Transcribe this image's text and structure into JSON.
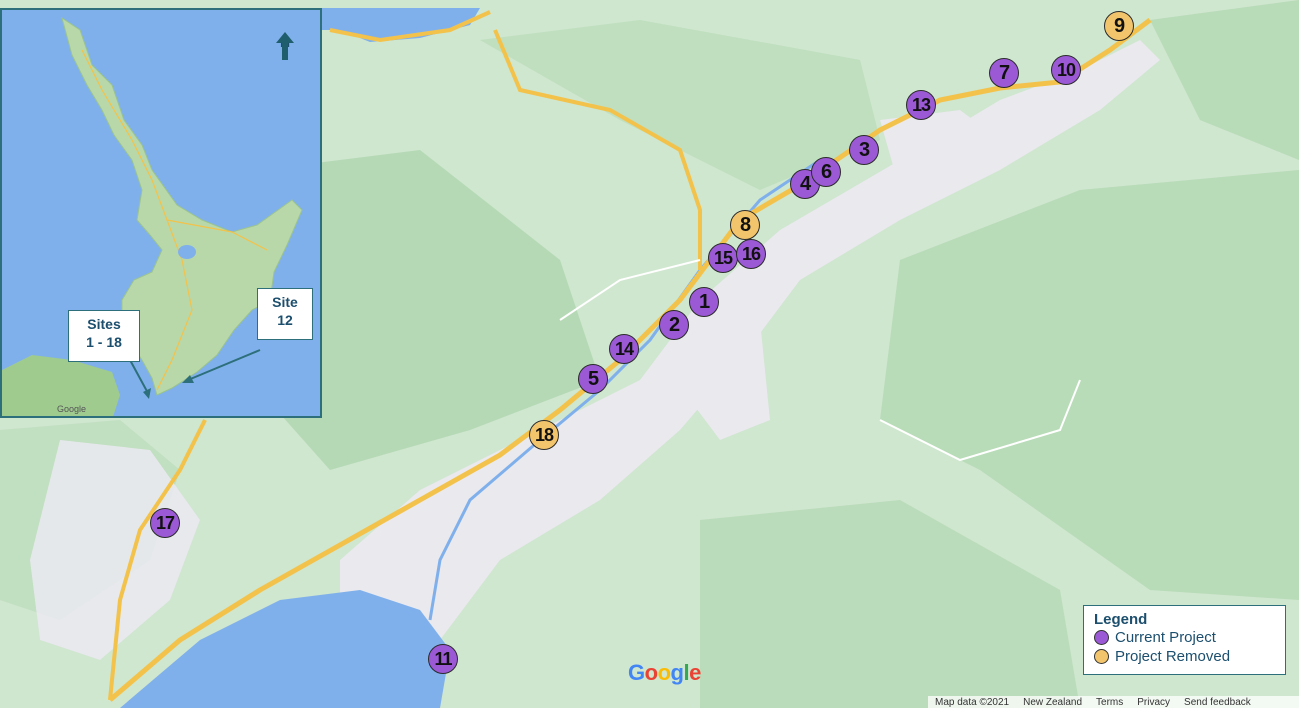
{
  "map": {
    "markers": [
      {
        "label": "1",
        "status": "current"
      },
      {
        "label": "2",
        "status": "current"
      },
      {
        "label": "3",
        "status": "current"
      },
      {
        "label": "4",
        "status": "current"
      },
      {
        "label": "5",
        "status": "current"
      },
      {
        "label": "6",
        "status": "current"
      },
      {
        "label": "7",
        "status": "current"
      },
      {
        "label": "8",
        "status": "removed"
      },
      {
        "label": "9",
        "status": "removed"
      },
      {
        "label": "10",
        "status": "current"
      },
      {
        "label": "11",
        "status": "current"
      },
      {
        "label": "13",
        "status": "current"
      },
      {
        "label": "14",
        "status": "current"
      },
      {
        "label": "15",
        "status": "current"
      },
      {
        "label": "16",
        "status": "current"
      },
      {
        "label": "17",
        "status": "current"
      },
      {
        "label": "18",
        "status": "removed"
      }
    ],
    "google_logo": [
      "G",
      "o",
      "o",
      "g",
      "l",
      "e"
    ],
    "attribution": [
      "Map data ©2021",
      "New Zealand",
      "Terms",
      "Privacy",
      "Send feedback"
    ]
  },
  "legend": {
    "title": "Legend",
    "items": [
      {
        "label": "Current Project",
        "color": "#9b59d6"
      },
      {
        "label": "Project Removed",
        "color": "#f2c46b"
      }
    ]
  },
  "inset": {
    "north_label": "N",
    "sites_label_line1": "Sites",
    "sites_label_line2": "1 - 18",
    "site12_label_line1": "Site",
    "site12_label_line2": "12",
    "google_label": "Google"
  },
  "colors": {
    "water": "#7fb0ec",
    "land": "#cfe6cf",
    "urban": "#e9e9ee",
    "highway": "#f3c24a",
    "accent": "#2d6f7a"
  }
}
